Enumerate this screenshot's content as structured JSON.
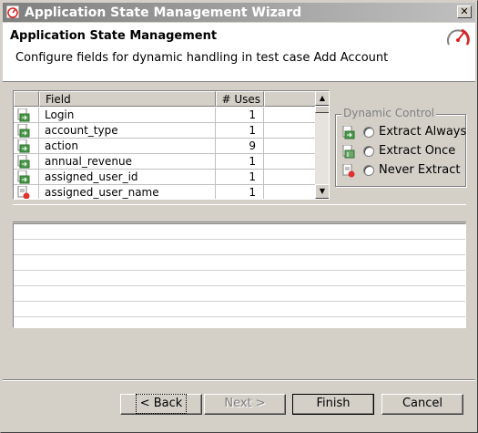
{
  "window": {
    "title": "Application State Management Wizard",
    "close_glyph": "✕"
  },
  "header": {
    "title": "Application State Management",
    "description": "Configure fields for dynamic handling in test case Add Account"
  },
  "table": {
    "columns": [
      "",
      "Field",
      "# Uses",
      ""
    ],
    "rows": [
      {
        "field": "Login",
        "uses": "1",
        "icon": "extract-always-icon"
      },
      {
        "field": "account_type",
        "uses": "1",
        "icon": "extract-always-icon"
      },
      {
        "field": "action",
        "uses": "9",
        "icon": "extract-always-icon"
      },
      {
        "field": "annual_revenue",
        "uses": "1",
        "icon": "extract-always-icon"
      },
      {
        "field": "assigned_user_id",
        "uses": "1",
        "icon": "extract-always-icon"
      },
      {
        "field": "assigned_user_name",
        "uses": "1",
        "icon": "never-extract-icon"
      }
    ]
  },
  "dynamic_control": {
    "legend": "Dynamic Control",
    "options": [
      {
        "label": "Extract Always",
        "icon": "extract-always-icon",
        "selected": false
      },
      {
        "label": "Extract Once",
        "icon": "extract-once-icon",
        "selected": false
      },
      {
        "label": "Never Extract",
        "icon": "never-extract-icon",
        "selected": false
      }
    ]
  },
  "buttons": {
    "back": "< Back",
    "next": "Next >",
    "finish": "Finish",
    "cancel": "Cancel"
  },
  "colors": {
    "title_gradient_start": "#7f7f7f",
    "title_gradient_end": "#c0c0c0",
    "panel_bg": "#d4d0c8",
    "gauge_red": "#e02020"
  }
}
